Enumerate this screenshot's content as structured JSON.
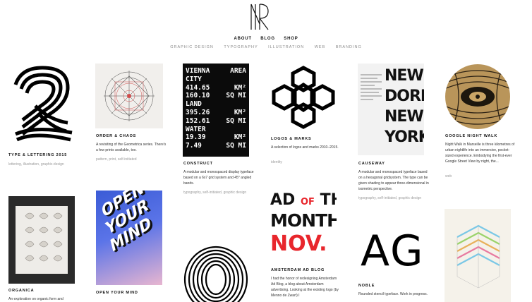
{
  "logo": {
    "alt": "NPR monogram"
  },
  "nav": {
    "primary": [
      "ABOUT",
      "BLOG",
      "SHOP"
    ],
    "categories": [
      "GRAPHIC DESIGN",
      "TYPOGRAPHY",
      "ILLUSTRATION",
      "WEB",
      "BRANDING"
    ]
  },
  "projects": [
    {
      "title": "TYPE & LETTERING 2015",
      "description": "",
      "tags": "lettering, illustration, graphic-design"
    },
    {
      "title": "ORDER & CHAOS",
      "description": "A revisiting of the Geometrica series. There's a few prints available, too.",
      "tags": "pattern, print, self-initiated"
    },
    {
      "title": "CONSTRUCT",
      "description": "A modular and monospaced display typeface based on a 6x7 grid system and 45° angled bands.",
      "tags": "typography, self-initiated, graphic design"
    },
    {
      "title": "LOGOS & MARKS",
      "description": "A selection of logos and marks 2010–2015.",
      "tags": "identity"
    },
    {
      "title": "CAUSEWAY",
      "description": "A modular and monospaced typeface based on a hexagonal gridsystem. The type can be given shading to appear three-dimensional in isometric perspective.",
      "tags": "typography, self-initiated, graphic design"
    },
    {
      "title": "GOOGLE NIGHT WALK",
      "description": "Night Walk in Marseille is three kilometres of urban nightlife into an immersive, pocket-sized experience. Embodying the first-ever Google Street View by night, the...",
      "tags": "web"
    },
    {
      "title": "ORGANICA",
      "description": "An exploration on organic form and",
      "tags": ""
    },
    {
      "title": "OPEN YOUR MIND",
      "description": "",
      "tags": ""
    },
    {
      "title": "",
      "description": "",
      "tags": ""
    },
    {
      "title": "AMSTERDAM AD BLOG",
      "description": "I had the honor of redesigning Amsterdam Ad Blog, a blog about Amsterdam advertising. Looking at the existing logo (by Menno de Zwart) I",
      "tags": ""
    },
    {
      "title": "NOBLE",
      "description": "Rounded stencil typeface. Work in progress.",
      "tags": ""
    },
    {
      "title": "",
      "description": "",
      "tags": ""
    }
  ],
  "artwork": {
    "construct_lines": [
      {
        "a": "VIENNA",
        "b": "AREA"
      },
      {
        "a": "CITY",
        "b": ""
      },
      {
        "a": "414.65",
        "b": "KM²"
      },
      {
        "a": "160.10",
        "b": "SQ MI"
      },
      {
        "a": "LAND",
        "b": ""
      },
      {
        "a": "395.26",
        "b": "KM²"
      },
      {
        "a": "152.61",
        "b": "SQ MI"
      },
      {
        "a": "WATER",
        "b": ""
      },
      {
        "a": "19.39",
        "b": "KM²"
      },
      {
        "a": "7.49",
        "b": "SQ MI"
      }
    ],
    "causeway_text": [
      "NEW",
      "DORP",
      "NEW",
      "YORK"
    ],
    "admonth": {
      "line1a": "AD",
      "line1b": "OF",
      "line1c": "THE",
      "line2": "MONTH",
      "line3": "NOV."
    },
    "open_mind_text": [
      "OPEN",
      "YOUR",
      "MIND"
    ],
    "noble_text": "AG"
  },
  "colors": {
    "accent_red": "#e8262c",
    "gray_text": "#9a9a9a",
    "construct_bg": "#0b0b0b",
    "open_mind_bg": "#3b5cd6"
  }
}
